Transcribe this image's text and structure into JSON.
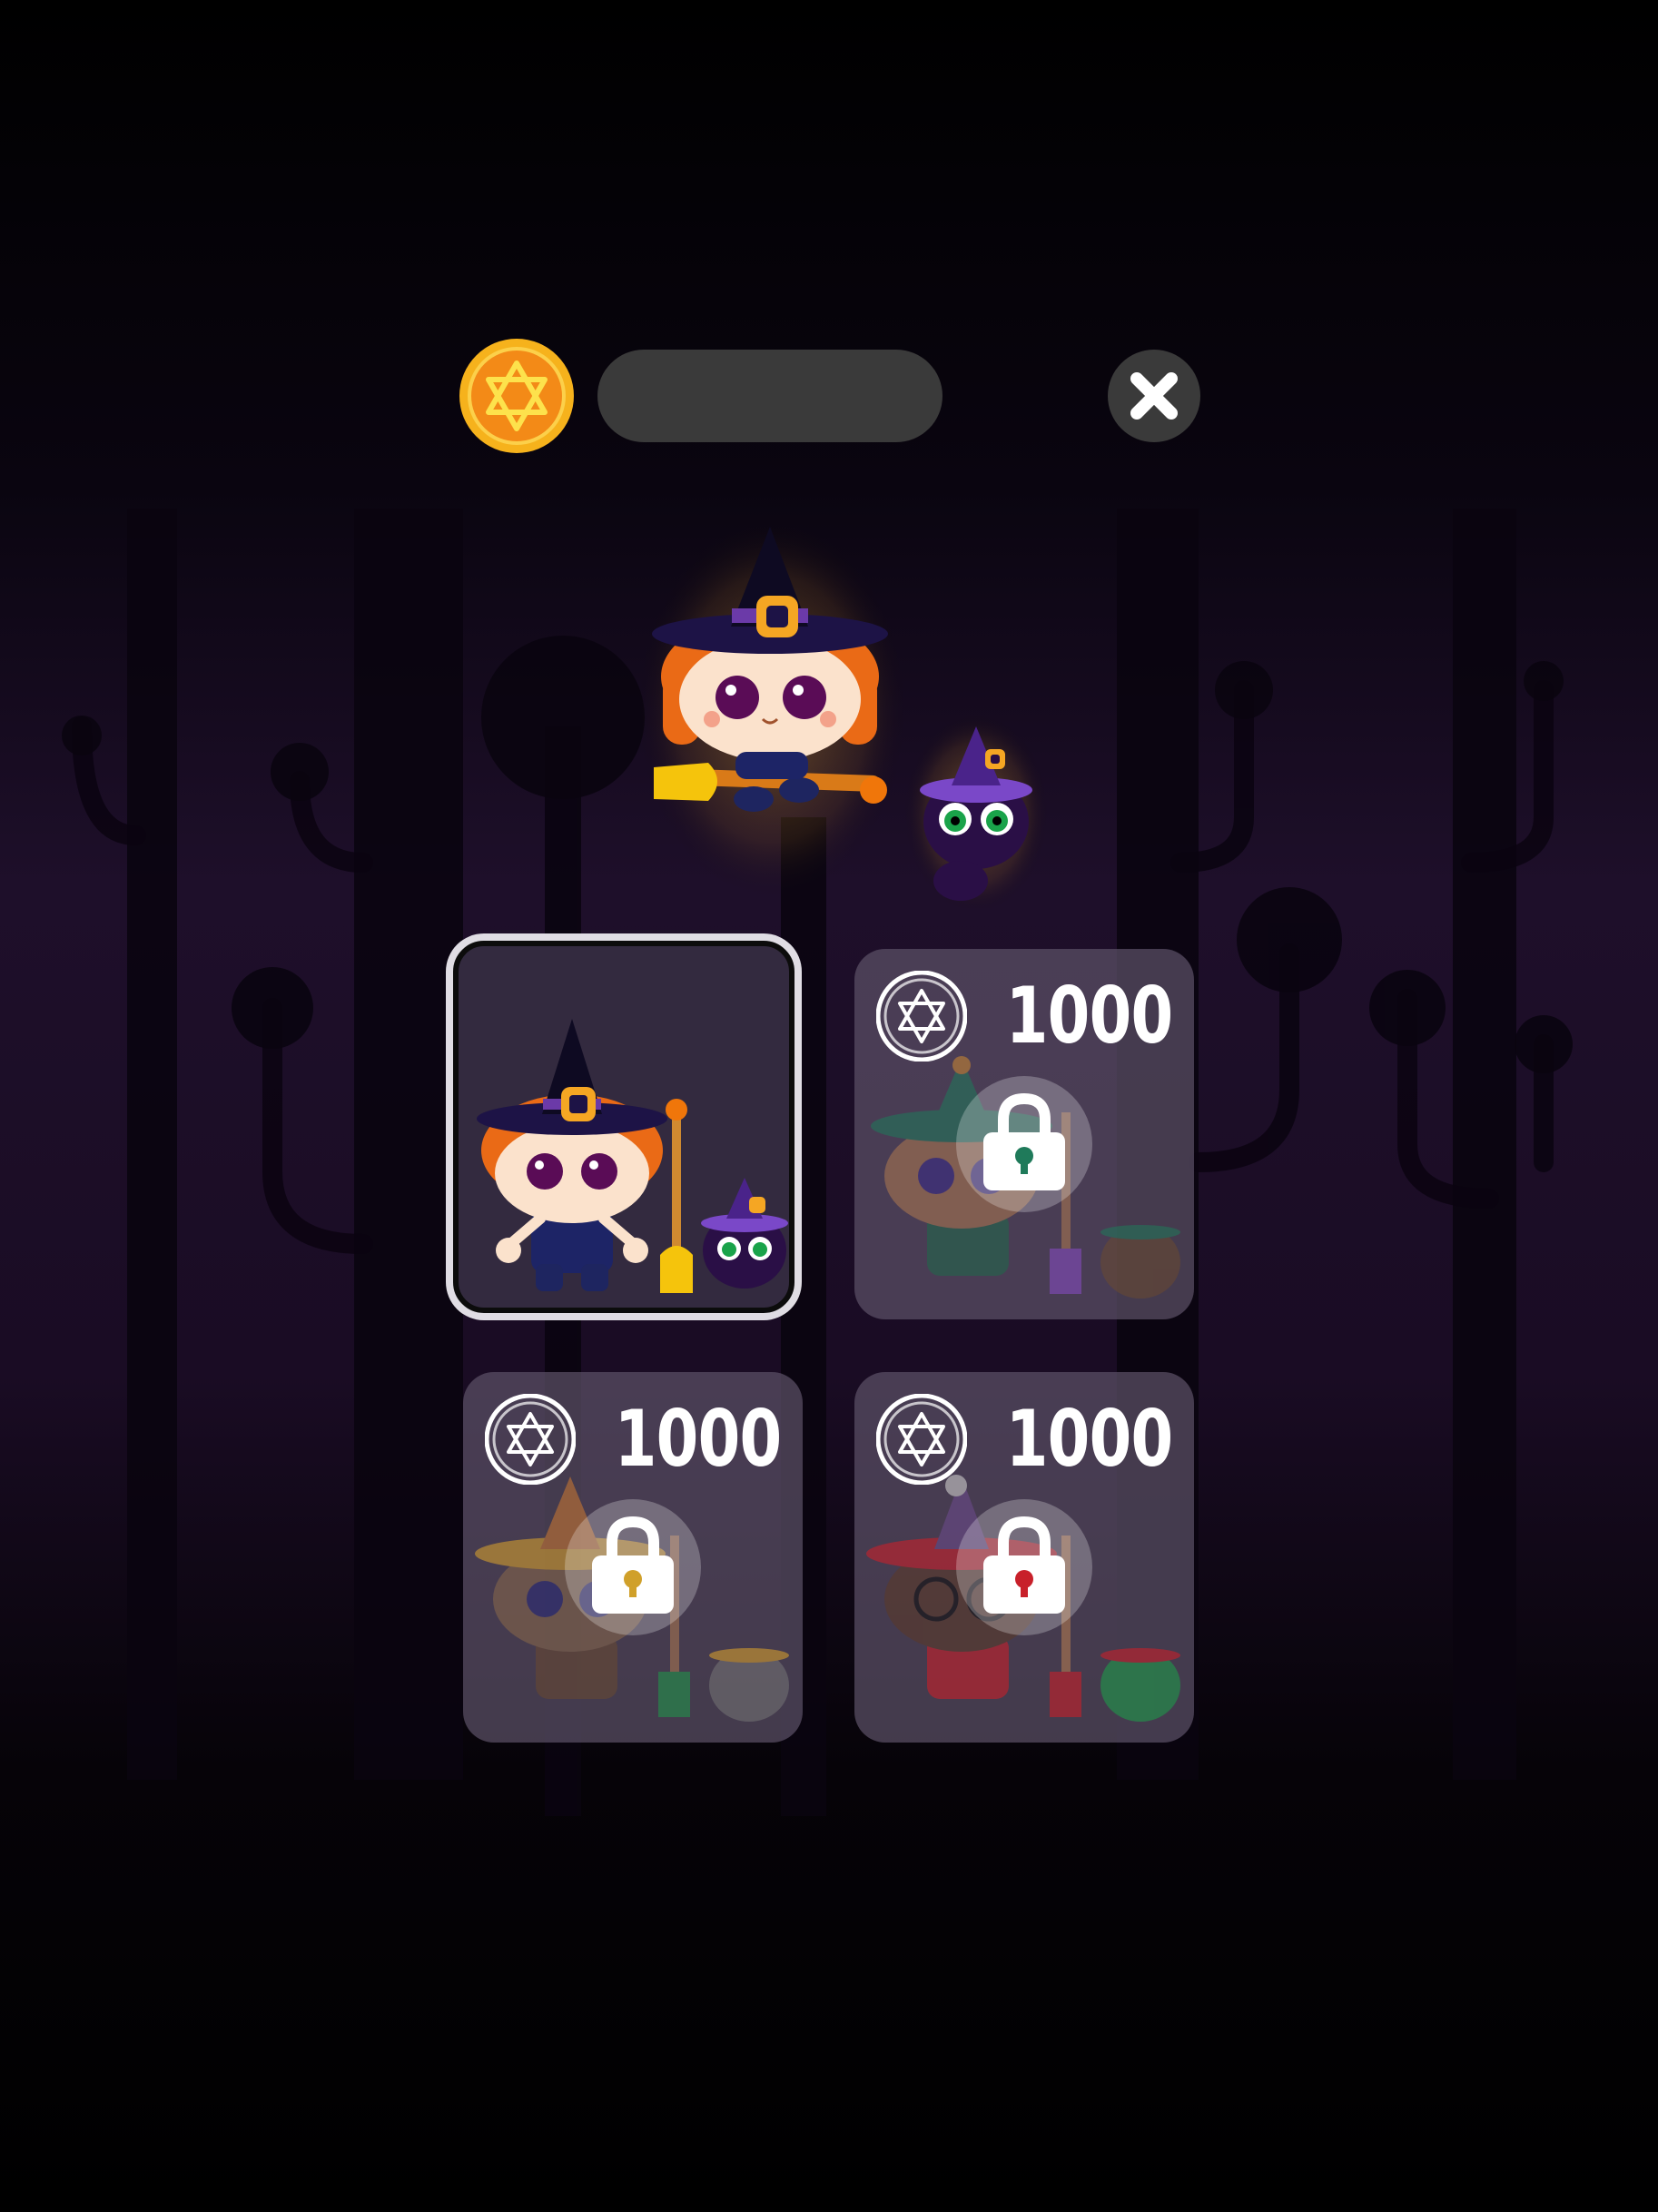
{
  "screen": "witch-outfit-shop",
  "header": {
    "coin_icon": "hexagram-coin-icon",
    "coin_balance": "",
    "close_icon": "close-x-icon"
  },
  "colors": {
    "background": "#000000",
    "forest": "#1e0f2a",
    "coin_gold": "#f6b21c",
    "card_locked": "#5c5066",
    "card_selected_border": "#e0dde4"
  },
  "outfits": [
    {
      "id": "classic-witch",
      "owned": true,
      "selected": true,
      "price": "",
      "hat_color": "#1d1346",
      "broom_color": "#f2c40c",
      "cat_color": "#2a0f46"
    },
    {
      "id": "green-witch",
      "owned": false,
      "selected": false,
      "price": "1000",
      "hat_color": "#1f7a5a",
      "broom_color": "#8a4cc8",
      "cat_color": "#6a4a30"
    },
    {
      "id": "yellow-witch",
      "owned": false,
      "selected": false,
      "price": "1000",
      "hat_color": "#e0a62a",
      "broom_color": "#1e9a4a",
      "cat_color": "#777777"
    },
    {
      "id": "red-witch",
      "owned": false,
      "selected": false,
      "price": "1000",
      "hat_color": "#c8202a",
      "broom_color": "#c8202a",
      "cat_color": "#1e9a4a"
    }
  ]
}
